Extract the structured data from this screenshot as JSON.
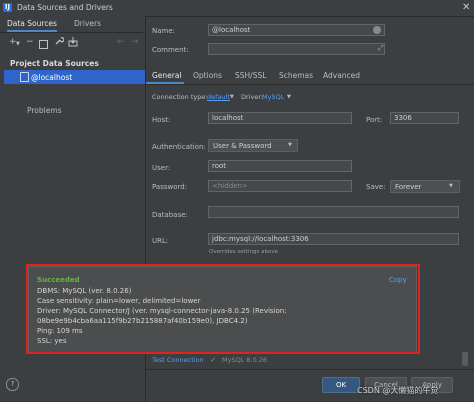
{
  "window": {
    "title": "Data Sources and Drivers",
    "close": "✕",
    "app_icon": "IJ"
  },
  "left": {
    "tabs": [
      "Data Sources",
      "Drivers"
    ],
    "toolbar": {
      "add": "+",
      "remove": "−",
      "back": "←",
      "forward": "→"
    },
    "section_title": "Project Data Sources",
    "items": [
      {
        "label": "@localhost"
      }
    ],
    "problems": "Problems",
    "help": "?"
  },
  "form": {
    "name_label": "Name:",
    "name_value": "@localhost",
    "comment_label": "Comment:",
    "tabs": [
      "General",
      "Options",
      "SSH/SSL",
      "Schemas",
      "Advanced"
    ],
    "connection_type_label": "Connection type:",
    "connection_type_value": "default",
    "driver_label": "Driver:",
    "driver_value": "MySQL",
    "host_label": "Host:",
    "host_value": "localhost",
    "port_label": "Port:",
    "port_value": "3306",
    "auth_label": "Authentication:",
    "auth_value": "User & Password",
    "user_label": "User:",
    "user_value": "root",
    "password_label": "Password:",
    "password_value": "<hidden>",
    "save_label": "Save:",
    "save_value": "Forever",
    "database_label": "Database:",
    "database_value": "",
    "url_label": "URL:",
    "url_value": "jdbc:mysql://localhost:3306",
    "url_hint": "Overrides settings above"
  },
  "popup": {
    "status": "Succeeded",
    "copy": "Copy",
    "lines": [
      "DBMS: MySQL (ver. 8.0.26)",
      "Case sensitivity: plain=lower, delimited=lower",
      "Driver: MySQL Connector/J (ver. mysql-connector-java-8.0.25 (Revision:",
      "08be9e9b4cba6aa115f9b27b215887af40b159e0), JDBC4.2)",
      "Ping: 109 ms",
      "SSL: yes"
    ],
    "outline_color": "#e0231c"
  },
  "test": {
    "label": "Test Connection",
    "check": "✓",
    "version": "MySQL 8.0.26"
  },
  "buttons": {
    "ok": "OK",
    "cancel": "Cancel",
    "apply": "Apply"
  },
  "watermark": "CSDN @大懒猫的午觉",
  "colors": {
    "accent": "#2f65ca",
    "link": "#589df6",
    "success": "#62b543",
    "background": "#3c3f41"
  }
}
